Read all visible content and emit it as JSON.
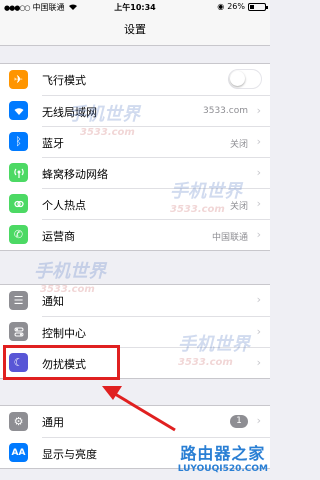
{
  "status_bar": {
    "carrier": "中国联通",
    "time": "上午10:34",
    "battery": "26%",
    "battery_level": 0.26
  },
  "nav": {
    "title": "设置"
  },
  "groups": [
    {
      "rows": [
        {
          "label": "飞行模式",
          "icon": "airplane-icon",
          "icon_color": "#ff9500",
          "control": "toggle",
          "toggle_on": false
        },
        {
          "label": "无线局域网",
          "icon": "wifi-icon",
          "icon_color": "#007aff",
          "value": "3533.com"
        },
        {
          "label": "蓝牙",
          "icon": "bluetooth-icon",
          "icon_color": "#007aff",
          "value": "关闭"
        },
        {
          "label": "蜂窝移动网络",
          "icon": "cellular-icon",
          "icon_color": "#4cd964"
        },
        {
          "label": "个人热点",
          "icon": "hotspot-icon",
          "icon_color": "#4cd964",
          "value": "关闭"
        },
        {
          "label": "运营商",
          "icon": "phone-icon",
          "icon_color": "#4cd964",
          "value": "中国联通"
        }
      ]
    },
    {
      "rows": [
        {
          "label": "通知",
          "icon": "notifications-icon",
          "icon_color": "#8e8e93"
        },
        {
          "label": "控制中心",
          "icon": "control-center-icon",
          "icon_color": "#8e8e93"
        },
        {
          "label": "勿扰模式",
          "icon": "moon-icon",
          "icon_color": "#5856d6"
        }
      ]
    },
    {
      "rows": [
        {
          "label": "通用",
          "icon": "gear-icon",
          "icon_color": "#8e8e93",
          "badge": "1"
        },
        {
          "label": "显示与亮度",
          "icon": "display-icon",
          "icon_color": "#007aff"
        }
      ]
    }
  ],
  "watermarks": {
    "site_cn": "手机世界",
    "site_num": "3533.com"
  },
  "brand": {
    "name": "路由器之家",
    "url": "LUYOUQI520.COM"
  },
  "colors": {
    "highlight": "#e02020",
    "background": "#efeff4"
  }
}
